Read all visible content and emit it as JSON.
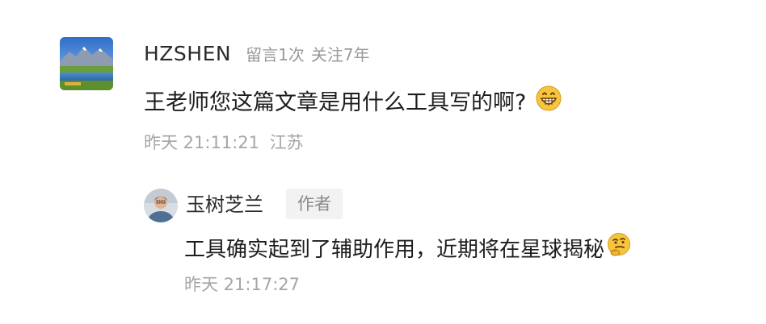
{
  "comment": {
    "username": "HZSHEN",
    "message_count": "留言1次",
    "follow_duration": "关注7年",
    "text": "王老师您这篇文章是用什么工具写的啊?",
    "emoji": "grin-face",
    "time": "昨天 21:11:21",
    "location": "江苏"
  },
  "reply": {
    "username": "玉树芝兰",
    "badge": "作者",
    "text": "工具确实起到了辅助作用，近期将在星球揭秘",
    "emoji": "thinking-face",
    "time": "昨天 21:17:27"
  },
  "colors": {
    "name": "#2b2b2b",
    "meta": "#9a9a9a",
    "text": "#1d1d1d",
    "badge_bg": "#f2f2f2",
    "emoji": "#f5c53c"
  }
}
